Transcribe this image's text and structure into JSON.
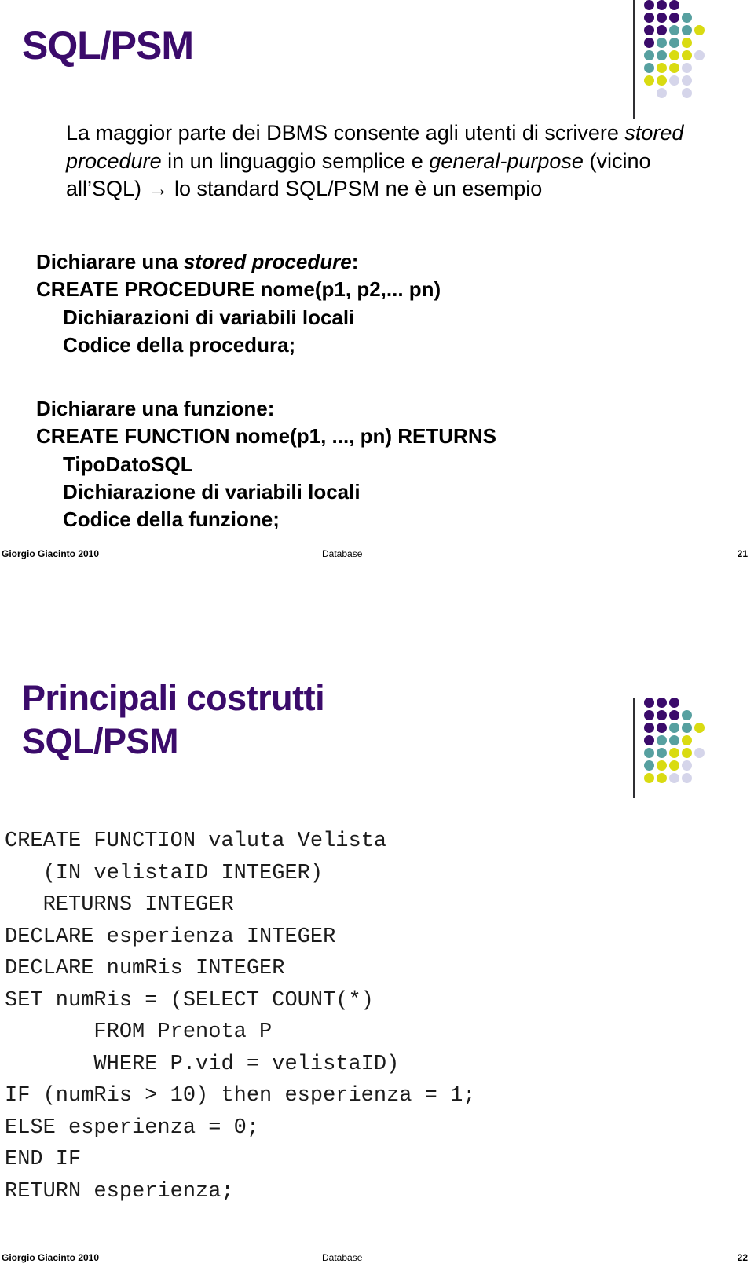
{
  "theme": {
    "title_color": "#3B0B6B",
    "dot_purple": "#3B0B6B",
    "dot_teal": "#57A0A0",
    "dot_yellow": "#D9DB12",
    "dot_lavender": "#D5D5EA",
    "rule_color": "#2F2F33",
    "text_color": "#000000"
  },
  "slide1": {
    "title": "SQL/PSM",
    "paragraph": {
      "part1": "La maggior parte dei DBMS consente agli utenti di scrivere ",
      "italic1": "stored procedure",
      "part2": " in un linguaggio semplice e ",
      "italic2": "general-purpose",
      "part3": " (vicino all’SQL) → lo standard SQL/PSM ne è un esempio"
    },
    "procedure_block": {
      "heading_prefix": "Dichiarare una ",
      "heading_italic": "stored procedure",
      "heading_suffix": ":",
      "line1": "CREATE PROCEDURE nome(p1, p2,... pn)",
      "line2": "Dichiarazioni di variabili locali",
      "line3": "Codice della procedura;"
    },
    "function_block": {
      "heading": "Dichiarare una funzione:",
      "line1": "CREATE FUNCTION nome(p1, ..., pn) RETURNS",
      "line2": "TipoDatoSQL",
      "line3": "Dichiarazione di variabili locali",
      "line4": "Codice della funzione;"
    },
    "footer": {
      "author": "Giorgio Giacinto 2010",
      "course": "Database",
      "page": "21"
    }
  },
  "slide2": {
    "title_line1": "Principali costrutti",
    "title_line2": "SQL/PSM",
    "code": "CREATE FUNCTION valuta Velista\n   (IN velistaID INTEGER)\n   RETURNS INTEGER\nDECLARE esperienza INTEGER\nDECLARE numRis INTEGER\nSET numRis = (SELECT COUNT(*)\n       FROM Prenota P\n       WHERE P.vid = velistaID)\nIF (numRis > 10) then esperienza = 1;\nELSE esperienza = 0;\nEND IF\nRETURN esperienza;",
    "footer": {
      "author": "Giorgio Giacinto 2010",
      "course": "Database",
      "page": "22"
    }
  },
  "dot_grid": {
    "rows": [
      [
        "p",
        "p",
        "p"
      ],
      [
        "p",
        "p",
        "p",
        "t"
      ],
      [
        "p",
        "p",
        "t",
        "t",
        "y"
      ],
      [
        "p",
        "t",
        "t",
        "y"
      ],
      [
        "t",
        "t",
        "y",
        "y",
        "l"
      ],
      [
        "t",
        "y",
        "y",
        "l"
      ],
      [
        "y",
        "y",
        "l",
        "l"
      ],
      [
        "s",
        "l",
        "s",
        "l"
      ]
    ]
  }
}
